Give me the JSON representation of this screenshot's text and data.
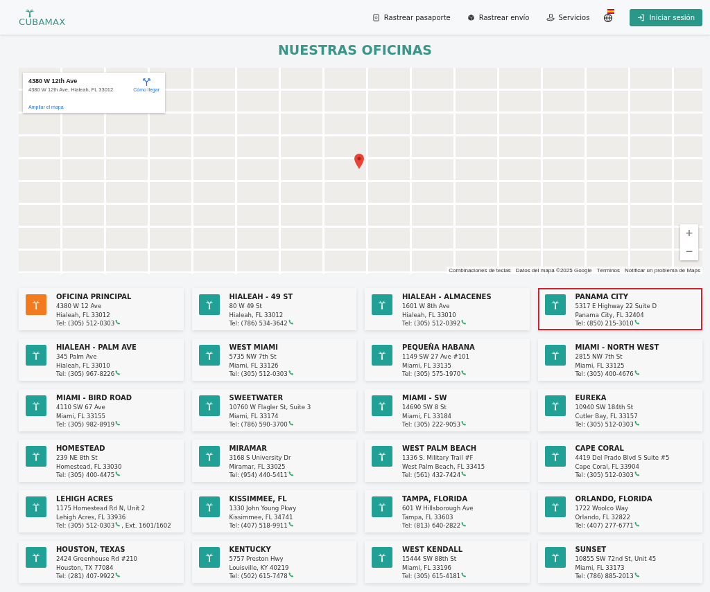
{
  "header": {
    "logo": "CUBAMAX",
    "nav": [
      {
        "label": "Rastrear pasaporte",
        "kind": "passport"
      },
      {
        "label": "Rastrear envío",
        "kind": "package"
      },
      {
        "label": "Servicios",
        "kind": "services"
      }
    ],
    "login": "Iniciar sesión"
  },
  "title": "NUESTRAS OFICINAS",
  "map": {
    "place_title": "4380 W 12th Ave",
    "place_address": "4380 W 12th Ave, Hialeah, FL 33012",
    "directions": "Cómo llegar",
    "enlarge": "Ampliar el mapa",
    "zoom_in": "+",
    "zoom_out": "−",
    "footer": [
      "Combinaciones de teclas",
      "Datos del mapa ©2025 Google",
      "Términos",
      "Notificar un problema de Maps"
    ]
  },
  "offices": [
    {
      "name": "OFICINA PRINCIPAL",
      "kind": "main",
      "highlighted": false,
      "address": "4380 W 12 Ave",
      "city": "Hialeah, FL 33012",
      "phone": "Tel: (305) 512-0303"
    },
    {
      "name": "HIALEAH - 49 ST",
      "kind": "branch",
      "highlighted": false,
      "address": "80 W 49 St",
      "city": "Hialeah, FL 33012",
      "phone": "Tel: (786) 534-3642"
    },
    {
      "name": "HIALEAH - ALMACENES",
      "kind": "branch",
      "highlighted": false,
      "address": "1601 W 8th Ave",
      "city": "Hialeah, FL 33010",
      "phone": "Tel: (305) 512-0392"
    },
    {
      "name": "PANAMA CITY",
      "kind": "branch",
      "highlighted": true,
      "address": "5317 E Highway 22 Suite D",
      "city": "Panama City, FL 32404",
      "phone": "Tel: (850) 215-3010"
    },
    {
      "name": "HIALEAH - PALM AVE",
      "kind": "branch",
      "highlighted": false,
      "address": "345 Palm Ave",
      "city": "Hialeah, FL 33010",
      "phone": "Tel: (305) 967-8226"
    },
    {
      "name": "WEST MIAMI",
      "kind": "branch",
      "highlighted": false,
      "address": "5735 NW 7th St",
      "city": "Miami, FL 33126",
      "phone": "Tel: (305) 512-0303"
    },
    {
      "name": "PEQUEÑA HABANA",
      "kind": "branch",
      "highlighted": false,
      "address": "1149 SW 27 Ave #101",
      "city": "Miami, FL 33135",
      "phone": "Tel: (305) 575-1970"
    },
    {
      "name": "MIAMI - NORTH WEST",
      "kind": "branch",
      "highlighted": false,
      "address": "2815 NW 7th St",
      "city": "Miami, FL 33125",
      "phone": "Tel: (305) 400-4676"
    },
    {
      "name": "MIAMI - BIRD ROAD",
      "kind": "branch",
      "highlighted": false,
      "address": "4110 SW 67 Ave",
      "city": "Miami, FL 33155",
      "phone": "Tel: (305) 982-8919"
    },
    {
      "name": "SWEETWATER",
      "kind": "branch",
      "highlighted": false,
      "address": "10760 W Flagler St, Suite 3",
      "city": "Miami, FL 33174",
      "phone": "Tel: (786) 590-3700"
    },
    {
      "name": "MIAMI - SW",
      "kind": "branch",
      "highlighted": false,
      "address": "14690 SW 8 St",
      "city": "Miami, FL 33184",
      "phone": "Tel: (305) 222-9053"
    },
    {
      "name": "EUREKA",
      "kind": "branch",
      "highlighted": false,
      "address": "10940 SW 184th St",
      "city": "Cutler Bay, FL 33157",
      "phone": "Tel: (305) 512-0303"
    },
    {
      "name": "HOMESTEAD",
      "kind": "branch",
      "highlighted": false,
      "address": "239 NE 8th St",
      "city": "Homestead, FL 33030",
      "phone": "Tel: (305) 400-4475"
    },
    {
      "name": "MIRAMAR",
      "kind": "branch",
      "highlighted": false,
      "address": "3168 S University Dr",
      "city": "Miramar, FL 33025",
      "phone": "Tel: (954) 440-5411"
    },
    {
      "name": "WEST PALM BEACH",
      "kind": "branch",
      "highlighted": false,
      "address": "1336 S. Military Trail #F",
      "city": "West Palm Beach, FL 33415",
      "phone": "Tel: (561) 432-7424"
    },
    {
      "name": "CAPE CORAL",
      "kind": "branch",
      "highlighted": false,
      "address": "4419 Del Prado Blvd S Suite #5",
      "city": "Cape Coral, FL 33904",
      "phone": "Tel: (305) 512-0303"
    },
    {
      "name": "LEHIGH ACRES",
      "kind": "branch",
      "highlighted": false,
      "address": "1175 Homestead Rd N, Unit 2",
      "city": "Lehigh Acres, FL 33936",
      "phone": "Tel: (305) 512-0303",
      "extension": ", Ext. 1601/1602"
    },
    {
      "name": "KISSIMMEE, FL",
      "kind": "branch",
      "highlighted": false,
      "address": "1330 John Young Pkwy",
      "city": "Kissimmee, FL 34741",
      "phone": "Tel: (407) 518-9911"
    },
    {
      "name": "TAMPA, FLORIDA",
      "kind": "branch",
      "highlighted": false,
      "address": "601 W Hillsborough Ave",
      "city": "Tampa, FL 33603",
      "phone": "Tel: (813) 640-2822"
    },
    {
      "name": "ORLANDO, FLORIDA",
      "kind": "branch",
      "highlighted": false,
      "address": "1722 Woolco Way",
      "city": "Orlando, FL 32822",
      "phone": "Tel: (407) 277-6771"
    },
    {
      "name": "HOUSTON, TEXAS",
      "kind": "branch",
      "highlighted": false,
      "address": "2424 Greenhouse Rd #210",
      "city": "Houston, TX 77084",
      "phone": "Tel: (281) 407-9922"
    },
    {
      "name": "KENTUCKY",
      "kind": "branch",
      "highlighted": false,
      "address": "5757 Preston Hwy",
      "city": "Louisville, KY 40219",
      "phone": "Tel: (502) 615-7478"
    },
    {
      "name": "WEST KENDALL",
      "kind": "branch",
      "highlighted": false,
      "address": "15444 SW 88th St",
      "city": "Miami, FL 33196",
      "phone": "Tel: (305) 615-4181"
    },
    {
      "name": "SUNSET",
      "kind": "branch",
      "highlighted": false,
      "address": "10855 SW 72nd St, Unit 45",
      "city": "Miami, FL 33173",
      "phone": "Tel: (786) 885-2013"
    }
  ]
}
